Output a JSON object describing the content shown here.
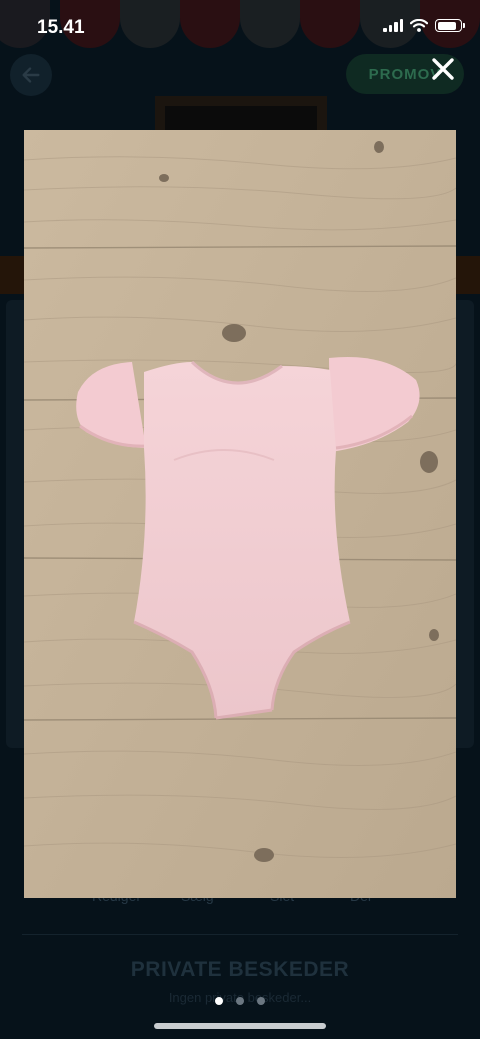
{
  "status_bar": {
    "time": "15.41",
    "battery_level": 0.85
  },
  "background": {
    "promo_label": "PROMOV",
    "tab_labels": [
      "Rediger",
      "Sælg",
      "Slet",
      "Del"
    ],
    "section_title": "PRIVATE BESKEDER",
    "section_subtitle": "Ingen private beskeder..."
  },
  "viewer": {
    "close_icon": "close-icon",
    "image_subject": "pink short-sleeved leotard on wooden floor",
    "page_count": 3,
    "current_page": 1
  },
  "colors": {
    "overlay": "#06121a",
    "wood": "#c6b49a",
    "garment": "#f2cfd3",
    "dot_active": "#ffffff",
    "dot_inactive": "#6b7781"
  }
}
